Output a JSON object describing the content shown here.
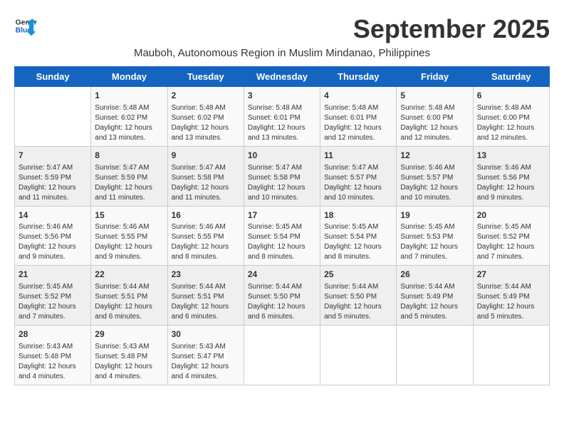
{
  "header": {
    "logo_line1": "General",
    "logo_line2": "Blue",
    "month_title": "September 2025",
    "subtitle": "Mauboh, Autonomous Region in Muslim Mindanao, Philippines"
  },
  "weekdays": [
    "Sunday",
    "Monday",
    "Tuesday",
    "Wednesday",
    "Thursday",
    "Friday",
    "Saturday"
  ],
  "weeks": [
    [
      {
        "day": "",
        "text": ""
      },
      {
        "day": "1",
        "text": "Sunrise: 5:48 AM\nSunset: 6:02 PM\nDaylight: 12 hours\nand 13 minutes."
      },
      {
        "day": "2",
        "text": "Sunrise: 5:48 AM\nSunset: 6:02 PM\nDaylight: 12 hours\nand 13 minutes."
      },
      {
        "day": "3",
        "text": "Sunrise: 5:48 AM\nSunset: 6:01 PM\nDaylight: 12 hours\nand 13 minutes."
      },
      {
        "day": "4",
        "text": "Sunrise: 5:48 AM\nSunset: 6:01 PM\nDaylight: 12 hours\nand 12 minutes."
      },
      {
        "day": "5",
        "text": "Sunrise: 5:48 AM\nSunset: 6:00 PM\nDaylight: 12 hours\nand 12 minutes."
      },
      {
        "day": "6",
        "text": "Sunrise: 5:48 AM\nSunset: 6:00 PM\nDaylight: 12 hours\nand 12 minutes."
      }
    ],
    [
      {
        "day": "7",
        "text": "Sunrise: 5:47 AM\nSunset: 5:59 PM\nDaylight: 12 hours\nand 11 minutes."
      },
      {
        "day": "8",
        "text": "Sunrise: 5:47 AM\nSunset: 5:59 PM\nDaylight: 12 hours\nand 11 minutes."
      },
      {
        "day": "9",
        "text": "Sunrise: 5:47 AM\nSunset: 5:58 PM\nDaylight: 12 hours\nand 11 minutes."
      },
      {
        "day": "10",
        "text": "Sunrise: 5:47 AM\nSunset: 5:58 PM\nDaylight: 12 hours\nand 10 minutes."
      },
      {
        "day": "11",
        "text": "Sunrise: 5:47 AM\nSunset: 5:57 PM\nDaylight: 12 hours\nand 10 minutes."
      },
      {
        "day": "12",
        "text": "Sunrise: 5:46 AM\nSunset: 5:57 PM\nDaylight: 12 hours\nand 10 minutes."
      },
      {
        "day": "13",
        "text": "Sunrise: 5:46 AM\nSunset: 5:56 PM\nDaylight: 12 hours\nand 9 minutes."
      }
    ],
    [
      {
        "day": "14",
        "text": "Sunrise: 5:46 AM\nSunset: 5:56 PM\nDaylight: 12 hours\nand 9 minutes."
      },
      {
        "day": "15",
        "text": "Sunrise: 5:46 AM\nSunset: 5:55 PM\nDaylight: 12 hours\nand 9 minutes."
      },
      {
        "day": "16",
        "text": "Sunrise: 5:46 AM\nSunset: 5:55 PM\nDaylight: 12 hours\nand 8 minutes."
      },
      {
        "day": "17",
        "text": "Sunrise: 5:45 AM\nSunset: 5:54 PM\nDaylight: 12 hours\nand 8 minutes."
      },
      {
        "day": "18",
        "text": "Sunrise: 5:45 AM\nSunset: 5:54 PM\nDaylight: 12 hours\nand 8 minutes."
      },
      {
        "day": "19",
        "text": "Sunrise: 5:45 AM\nSunset: 5:53 PM\nDaylight: 12 hours\nand 7 minutes."
      },
      {
        "day": "20",
        "text": "Sunrise: 5:45 AM\nSunset: 5:52 PM\nDaylight: 12 hours\nand 7 minutes."
      }
    ],
    [
      {
        "day": "21",
        "text": "Sunrise: 5:45 AM\nSunset: 5:52 PM\nDaylight: 12 hours\nand 7 minutes."
      },
      {
        "day": "22",
        "text": "Sunrise: 5:44 AM\nSunset: 5:51 PM\nDaylight: 12 hours\nand 6 minutes."
      },
      {
        "day": "23",
        "text": "Sunrise: 5:44 AM\nSunset: 5:51 PM\nDaylight: 12 hours\nand 6 minutes."
      },
      {
        "day": "24",
        "text": "Sunrise: 5:44 AM\nSunset: 5:50 PM\nDaylight: 12 hours\nand 6 minutes."
      },
      {
        "day": "25",
        "text": "Sunrise: 5:44 AM\nSunset: 5:50 PM\nDaylight: 12 hours\nand 5 minutes."
      },
      {
        "day": "26",
        "text": "Sunrise: 5:44 AM\nSunset: 5:49 PM\nDaylight: 12 hours\nand 5 minutes."
      },
      {
        "day": "27",
        "text": "Sunrise: 5:44 AM\nSunset: 5:49 PM\nDaylight: 12 hours\nand 5 minutes."
      }
    ],
    [
      {
        "day": "28",
        "text": "Sunrise: 5:43 AM\nSunset: 5:48 PM\nDaylight: 12 hours\nand 4 minutes."
      },
      {
        "day": "29",
        "text": "Sunrise: 5:43 AM\nSunset: 5:48 PM\nDaylight: 12 hours\nand 4 minutes."
      },
      {
        "day": "30",
        "text": "Sunrise: 5:43 AM\nSunset: 5:47 PM\nDaylight: 12 hours\nand 4 minutes."
      },
      {
        "day": "",
        "text": ""
      },
      {
        "day": "",
        "text": ""
      },
      {
        "day": "",
        "text": ""
      },
      {
        "day": "",
        "text": ""
      }
    ]
  ]
}
